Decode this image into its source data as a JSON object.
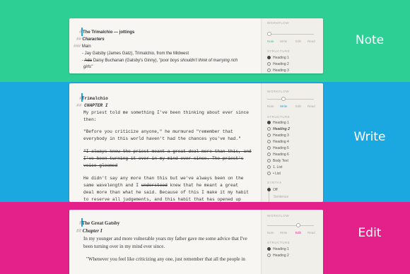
{
  "panels": [
    {
      "mode_title": "Note",
      "workflow_label": "WORKFLOW",
      "modes": [
        "Note",
        "Write",
        "Edit",
        "Read"
      ],
      "active_mode": 0,
      "active_color": "#2ecf95",
      "structure_label": "STRUCTURE",
      "structure_options": [
        "Heading 1",
        "Heading 2",
        "Heading 3"
      ],
      "selected_structure": 0,
      "doc": {
        "title_mark": "#",
        "title": "The Trimalchio — jottings",
        "subtitle_mark": "##",
        "subtitle": "Characters",
        "section_mark": "###",
        "section": "Main",
        "line1": "- Jay Gatsby (James Gatz), Trimalchio, from the Midwest",
        "line2_prefix": "- ",
        "line2_strike": "Ada",
        "line2_rest": " Daisy Buchanan (Gatsby's Ginny), ",
        "line2_italic": "\"poor boys shouldn't think of marrying rich",
        "line3": "girls\""
      }
    },
    {
      "mode_title": "Write",
      "workflow_label": "WORKFLOW",
      "modes": [
        "Note",
        "Write",
        "Edit",
        "Read"
      ],
      "active_mode": 1,
      "active_color": "#1ba8e0",
      "structure_label": "STRUCTURE",
      "structure_options": [
        "Heading 1",
        "Heading 2",
        "Heading 3",
        "Heading 4",
        "Heading 5",
        "Heading 6",
        "Body Text",
        "1. List",
        "• List"
      ],
      "selected_structure": 0,
      "syntax_label": "SYNTAX",
      "syntax_options": [
        "Off",
        "Sentence"
      ],
      "selected_syntax": 0,
      "doc": {
        "title_mark": "#",
        "title": "Trimalchio",
        "subtitle_mark": "##",
        "subtitle": "CHAPTER I",
        "p1a": "My priest told me something I've been thinking about ever since",
        "p1b": "then:",
        "p2a": "\"Before you criticize anyone,\" he murmured \"remember that",
        "p2b": "everybody in this world haven't had the chances you've had.\"",
        "p3a": "\"I always knew the priest meant a great deal more than this, and",
        "p3b": "I've been turning it over in my mind ever since. The priest's",
        "p3c": "voice gloomed",
        "p4a": "He didn't say any more than this but we've always been on the",
        "p4b_pre": "same wavelength and I ",
        "p4b_strike": "understood",
        "p4b_post": " knew that he meant a great",
        "p4c": "deal more than what he said. Because of this I make it my habit",
        "p4d": "to reserve all judgements, and this habit that has opened up"
      }
    },
    {
      "mode_title": "Edit",
      "workflow_label": "WORKFLOW",
      "modes": [
        "Note",
        "Write",
        "Edit",
        "Read"
      ],
      "active_mode": 2,
      "active_color": "#e4218a",
      "structure_label": "STRUCTURE",
      "structure_options": [
        "Heading 1",
        "Heading 2"
      ],
      "selected_structure": 0,
      "doc": {
        "title_mark": "#",
        "title": "The Great Gatsby",
        "subtitle_mark": "##",
        "subtitle": "Chapter I",
        "p1a": "In my younger and more vulnerable years my father gave me some advice that I've",
        "p1b": "been turning over in my mind ever since.",
        "p2": "\"Whenever you feel like criticizing any one, just remember that all the people in"
      }
    }
  ]
}
